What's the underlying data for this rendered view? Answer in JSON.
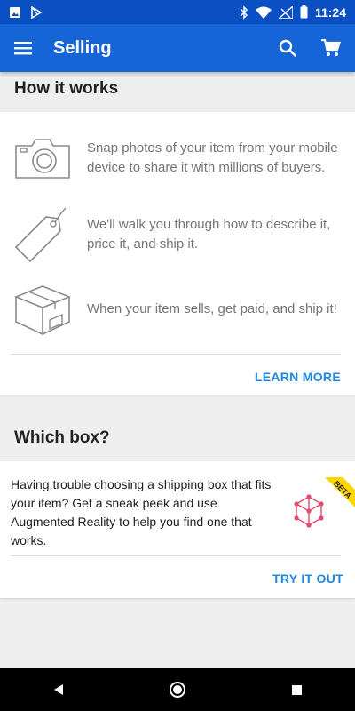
{
  "status": {
    "time": "11:24"
  },
  "app_bar": {
    "title": "Selling"
  },
  "how_it_works": {
    "title": "How it works",
    "steps": [
      {
        "icon": "camera-icon",
        "text": "Snap photos of your item from your mobile device to share it with millions of buyers."
      },
      {
        "icon": "price-tag-icon",
        "text": "We'll walk you through how to describe it, price it, and ship it."
      },
      {
        "icon": "shipping-box-icon",
        "text": "When your item sells, get paid, and ship it!"
      }
    ],
    "learn_more": "LEARN MORE"
  },
  "which_box": {
    "title": "Which box?",
    "description": "Having trouble choosing a shipping box that fits your item? Get a sneak peek and use Augmented Reality to help you find one that works.",
    "badge": "BETA",
    "try_it_out": "TRY IT OUT"
  },
  "colors": {
    "app_bar": "#1565d8",
    "status_bar": "#0a4fc4",
    "link": "#1e88e5",
    "badge": "#ffd600",
    "ar_icon": "#e8476b"
  }
}
